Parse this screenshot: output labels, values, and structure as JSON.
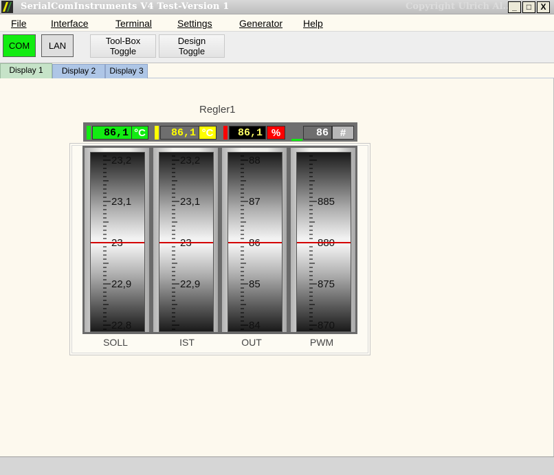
{
  "window": {
    "title": "SerialComInstruments V4   Test-Version 1",
    "copyright": "Copyright Ulrich Al...",
    "minimize": "_",
    "maximize": "□",
    "close": "X"
  },
  "menu": [
    {
      "label": "File"
    },
    {
      "label": "Interface"
    },
    {
      "label": "Terminal"
    },
    {
      "label": "Settings"
    },
    {
      "label": "Generator"
    },
    {
      "label": "Help"
    }
  ],
  "toolbar": {
    "com": "COM",
    "lan": "LAN",
    "toolbox": {
      "line1": "Tool-Box",
      "line2": "Toggle"
    },
    "design": {
      "line1": "Design",
      "line2": "Toggle"
    }
  },
  "tabs": [
    {
      "label": "Display 1",
      "active": true
    },
    {
      "label": "Display 2",
      "active": false
    },
    {
      "label": "Display 3",
      "active": false
    }
  ],
  "regler": {
    "title": "Regler1",
    "displays": [
      {
        "value": "86,1",
        "unit": "°C",
        "bar_color": "#12ec12",
        "value_bg": "#12ec12",
        "value_color": "#000000",
        "unit_bg": "#12ec12",
        "unit_color": "#ffffff"
      },
      {
        "value": "86,1",
        "unit": "°C",
        "bar_color": "#ffff00",
        "value_bg": "#6e6e6e",
        "value_color": "#ffff00",
        "unit_bg": "#ffff00",
        "unit_color": "#ffffff"
      },
      {
        "value": "86,1",
        "unit": "%",
        "bar_color": "#ff0000",
        "value_bg": "#000000",
        "value_color": "#ffff66",
        "unit_bg": "#ff0000",
        "unit_color": "#ffffff"
      },
      {
        "value": "86",
        "unit": "#",
        "bar_color": "#12ec12",
        "value_bg": "#6e6e6e",
        "value_color": "#ffffff",
        "unit_bg": "#b8b8b8",
        "unit_color": "#ffffff"
      }
    ],
    "gauges": [
      {
        "name": "SOLL",
        "center": 23,
        "step": 0.1,
        "range": 0.2,
        "labels": [
          "23,2",
          "23,1",
          "23",
          "22,9",
          "22,8"
        ]
      },
      {
        "name": "IST",
        "center": 23,
        "step": 0.1,
        "range": 0.2,
        "labels": [
          "23,2",
          "23,1",
          "23",
          "22,9",
          ""
        ]
      },
      {
        "name": "OUT",
        "center": 86,
        "step": 1,
        "range": 2,
        "labels": [
          "88",
          "87",
          "86",
          "85",
          "84"
        ]
      },
      {
        "name": "PWM",
        "center": 880,
        "step": 5,
        "range": 10,
        "labels": [
          "",
          "885",
          "880",
          "875",
          "870"
        ]
      }
    ],
    "indicator_color": "#d40000"
  }
}
